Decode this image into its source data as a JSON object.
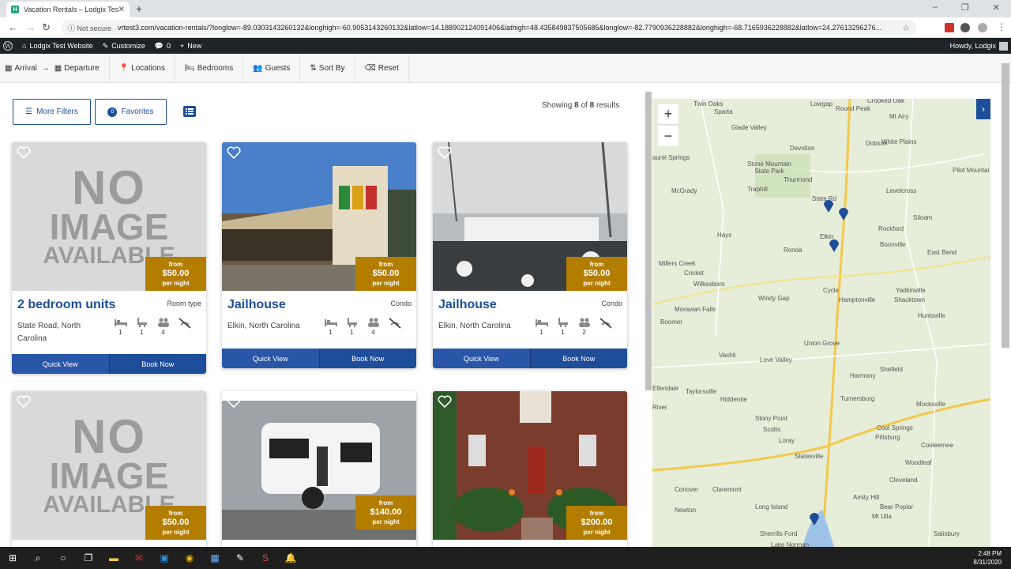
{
  "browser": {
    "tab_title": "Vacation Rentals – Lodgix Test W",
    "not_secure": "Not secure",
    "url": "vrtest3.com/vacation-rentals/?longlow=-89.0303143260132&longhigh=-60.9053143260132&latlow=14.188902124091406&lathigh=48.435849837505685&longlow=-82.7790936228882&longhigh=-68.7165936228882&latlow=24.27613296276..."
  },
  "wpbar": {
    "site": "Lodgix Test Website",
    "customize": "Customize",
    "comments": "0",
    "new": "New",
    "howdy": "Howdy, Lodgix"
  },
  "filters": {
    "arrival": "Arrival",
    "arrow": "→",
    "departure": "Departure",
    "locations": "Locations",
    "bedrooms": "Bedrooms",
    "guests": "Guests",
    "sort_by": "Sort By",
    "reset": "Reset"
  },
  "toolbar": {
    "more_filters": "More Filters",
    "favorites_count": "0",
    "favorites": "Favorites",
    "showing_prefix": "Showing",
    "showing_count": "8",
    "showing_of": "of",
    "showing_total": "8",
    "showing_suffix": "results"
  },
  "noimage": {
    "w1": "NO",
    "w2": "IMAGE",
    "w3": "AVAILABLE"
  },
  "cards": [
    {
      "name": "2 bedroom units",
      "type": "Room type",
      "location": "State Road, North Carolina",
      "price_from": "from",
      "price": "$50.00",
      "per": "per night",
      "beds": "1",
      "baths": "1",
      "guests": "4",
      "quick": "Quick View",
      "book": "Book Now"
    },
    {
      "name": "Jailhouse",
      "type": "Condo",
      "location": "Elkin, North Carolina",
      "price_from": "from",
      "price": "$50.00",
      "per": "per night",
      "beds": "1",
      "baths": "1",
      "guests": "4",
      "quick": "Quick View",
      "book": "Book Now"
    },
    {
      "name": "Jailhouse",
      "type": "Condo",
      "location": "Elkin, North Carolina",
      "price_from": "from",
      "price": "$50.00",
      "per": "per night",
      "beds": "1",
      "baths": "1",
      "guests": "2",
      "quick": "Quick View",
      "book": "Book Now"
    },
    {
      "price_from": "from",
      "price": "$50.00",
      "per": "per night"
    },
    {
      "price_from": "from",
      "price": "$140.00",
      "per": "per night"
    },
    {
      "price_from": "from",
      "price": "$200.00",
      "per": "per night"
    }
  ],
  "map": {
    "zoom_in": "+",
    "zoom_out": "−",
    "towns": [
      "Twin Oaks",
      "Lowgap",
      "Crooked Oak",
      "Sparta",
      "Round Peak",
      "Mt Airy",
      "Glade Valley",
      "White Plains",
      "Devotion",
      "Dobson",
      "aurel Springs",
      "Stone Mountain State Park",
      "Thurmond",
      "Pilot Mountai",
      "McGrady",
      "Traphill",
      "Levelcross",
      "State Rd",
      "Siloam",
      "Hays",
      "Elkin",
      "Rockford",
      "Boonville",
      "Ronda",
      "East Bend",
      "Millers Creek",
      "Cricket",
      "Wilkesboro",
      "Yadkinville",
      "Cycle",
      "Hamptonville",
      "Moravian Falls",
      "Windy Gap",
      "Shacktown",
      "Huntsville",
      "Boomer",
      "Union Grove",
      "Vashti",
      "Love Valley",
      "Shefield",
      "Harmony",
      "Taylorsville",
      "Hiddenite",
      "Turnersburg",
      "Mocksville",
      "River",
      "Stony Point",
      "Scotts",
      "Cool Springs",
      "Loray",
      "Pittsburg",
      "Cooleemee",
      "Statesville",
      "Woodleaf",
      "Conover",
      "Claremont",
      "Cleveland",
      "Amity Hill",
      "Newton",
      "Long Island",
      "Bear Poplar",
      "Mt Ulla",
      "Sherrills Ford",
      "Salisbury",
      "Lake Norman",
      "Ellendale"
    ]
  },
  "clock": {
    "time": "2:48 PM",
    "date": "8/31/2020"
  },
  "colors": {
    "accent": "#1e4d9a",
    "price_badge": "#b37d00"
  }
}
